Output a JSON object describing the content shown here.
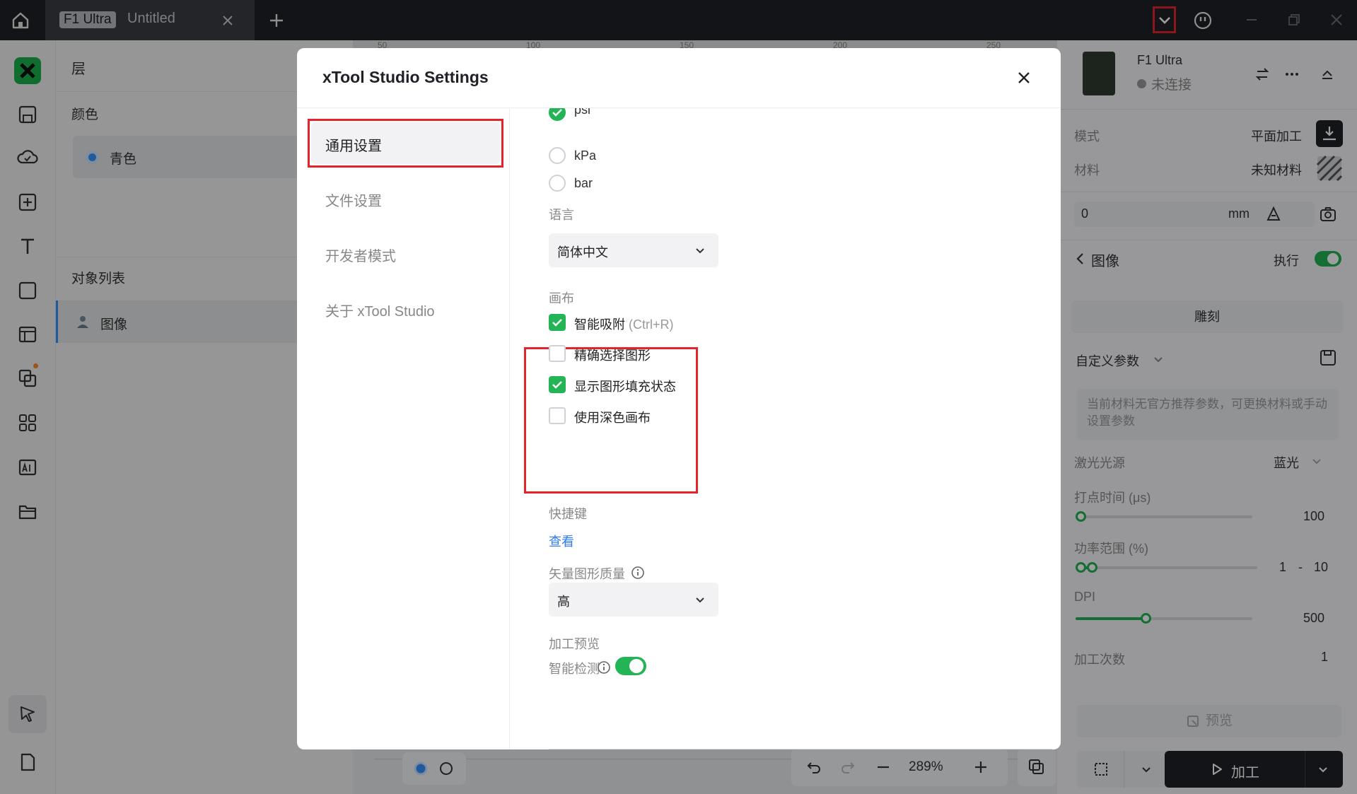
{
  "titlebar": {
    "tab_badge": "F1 Ultra",
    "tab_title": "Untitled"
  },
  "layer_panel": {
    "title": "层",
    "color_section": "颜色",
    "color_item": "青色",
    "object_section": "对象列表",
    "object_item": "图像"
  },
  "canvas": {
    "ruler_ticks": [
      "50",
      "100",
      "150",
      "200",
      "250"
    ],
    "zoom": "289%"
  },
  "right_panel": {
    "device_name": "F1 Ultra",
    "device_status": "未连接",
    "mode_label": "模式",
    "mode_value": "平面加工",
    "material_label": "材料",
    "material_value": "未知材料",
    "height_value": "0",
    "height_unit": "mm",
    "section_title": "图像",
    "execute_label": "执行",
    "engrave_label": "雕刻",
    "custom_params": "自定义参数",
    "hint": "当前材料无官方推荐参数，可更换材料或手动设置参数",
    "laser_source_label": "激光光源",
    "laser_source_value": "蓝光",
    "dot_time_label": "打点时间 (μs)",
    "dot_time_value": "100",
    "power_label": "功率范围 (%)",
    "power_min": "1",
    "power_sep": "-",
    "power_max": "10",
    "dpi_label": "DPI",
    "dpi_value": "500",
    "passes_label": "加工次数",
    "passes_value": "1",
    "preview_label": "预览",
    "process_label": "加工"
  },
  "dialog": {
    "title": "xTool Studio Settings",
    "nav": {
      "general": "通用设置",
      "file": "文件设置",
      "developer": "开发者模式",
      "about": "关于 xTool Studio"
    },
    "pressure_options": {
      "psi": "psi",
      "kpa": "kPa",
      "bar": "bar",
      "selected": "psi"
    },
    "language": {
      "label": "语言",
      "value": "简体中文"
    },
    "canvas": {
      "label": "画布",
      "smart_snap": "智能吸附",
      "smart_snap_hint": "(Ctrl+R)",
      "smart_snap_checked": true,
      "precise_select": "精确选择图形",
      "precise_select_checked": false,
      "show_fill": "显示图形填充状态",
      "show_fill_checked": true,
      "dark_canvas": "使用深色画布",
      "dark_canvas_checked": false
    },
    "shortcuts": {
      "label": "快捷键",
      "link": "查看"
    },
    "vector_quality": {
      "label": "矢量图形质量",
      "value": "高"
    },
    "process_preview": {
      "label": "加工预览",
      "smart_detect": "智能检测",
      "smart_detect_on": true
    }
  },
  "colors": {
    "accent_green": "#22b455",
    "highlight_red": "#e3242b",
    "link_blue": "#2f7cf6"
  }
}
